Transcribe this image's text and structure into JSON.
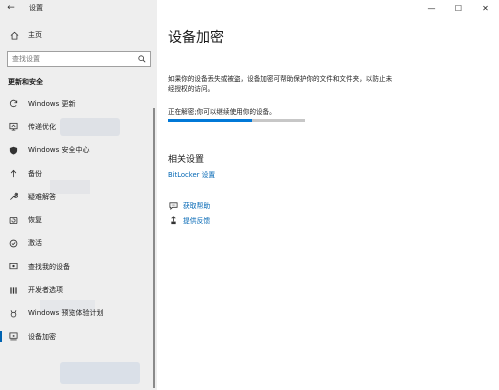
{
  "window": {
    "title": "设置",
    "back_glyph": "←",
    "minimize_glyph": "—",
    "maximize_glyph": "☐",
    "close_glyph": "✕"
  },
  "sidebar": {
    "home_label": "主页",
    "search_placeholder": "查找设置",
    "section_title": "更新和安全",
    "items": [
      {
        "label": "Windows 更新",
        "icon": "sync-icon"
      },
      {
        "label": "传递优化",
        "icon": "delivery-optimization-icon"
      },
      {
        "label": "Windows 安全中心",
        "icon": "shield-icon"
      },
      {
        "label": "备份",
        "icon": "backup-icon"
      },
      {
        "label": "疑难解答",
        "icon": "wrench-icon"
      },
      {
        "label": "恢复",
        "icon": "recovery-icon"
      },
      {
        "label": "激活",
        "icon": "activation-icon"
      },
      {
        "label": "查找我的设备",
        "icon": "find-device-icon"
      },
      {
        "label": "开发者选项",
        "icon": "developer-icon"
      },
      {
        "label": "Windows 预览体验计划",
        "icon": "insider-icon"
      },
      {
        "label": "设备加密",
        "icon": "encryption-icon",
        "selected": true
      }
    ]
  },
  "main": {
    "title": "设备加密",
    "description": "如果你的设备丢失或被盗，设备加密可帮助保护你的文件和文件夹，以防止未经授权的访问。",
    "status": "正在解密;你可以继续使用你的设备。",
    "progress": 0.61,
    "related_title": "相关设置",
    "bitlocker_link": "BitLocker 设置",
    "get_help": "获取帮助",
    "feedback": "提供反馈"
  },
  "colors": {
    "accent": "#0078d7",
    "link": "#0066b4",
    "sidebar_bg": "#eeeeee",
    "selected_bar": "#0063b1"
  }
}
